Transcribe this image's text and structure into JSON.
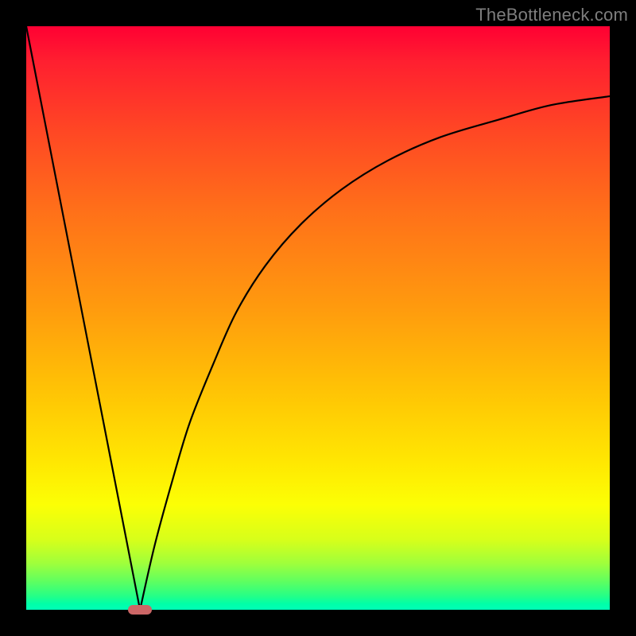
{
  "watermark": "TheBottleneck.com",
  "colors": {
    "frame": "#000000",
    "curve": "#000000",
    "marker": "#cc6666",
    "gradient_top": "#ff0033",
    "gradient_bottom": "#00ffb8"
  },
  "chart_data": {
    "type": "line",
    "title": "",
    "xlabel": "",
    "ylabel": "",
    "xlim": [
      0,
      100
    ],
    "ylim": [
      0,
      100
    ],
    "grid": false,
    "series": [
      {
        "name": "left-segment",
        "x": [
          0,
          19.5
        ],
        "values": [
          100,
          0
        ]
      },
      {
        "name": "right-segment",
        "x": [
          19.5,
          22,
          25,
          28,
          32,
          36,
          41,
          47,
          54,
          62,
          71,
          81,
          90,
          100
        ],
        "values": [
          0,
          11,
          22,
          32,
          42,
          51,
          59,
          66,
          72,
          77,
          81,
          84,
          86.5,
          88
        ]
      }
    ],
    "annotations": [
      {
        "name": "min-marker",
        "x": 19.5,
        "y": 0,
        "width_pct": 4,
        "height_pct": 1.6
      }
    ]
  }
}
